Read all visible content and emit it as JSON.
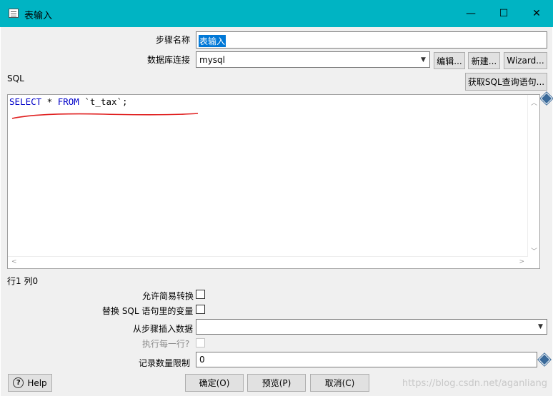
{
  "window": {
    "title": "表输入",
    "minimize": "—",
    "maximize": "☐",
    "close": "✕"
  },
  "form": {
    "step_name_label": "步骤名称",
    "step_name_value": "表输入",
    "db_conn_label": "数据库连接",
    "db_conn_value": "mysql",
    "edit_btn": "编辑...",
    "new_btn": "新建...",
    "wizard_btn": "Wizard...",
    "sql_label": "SQL",
    "get_sql_btn": "获取SQL查询语句...",
    "sql_kw1": "SELECT",
    "sql_mid": " * ",
    "sql_kw2": "FROM",
    "sql_table": " `t_tax`;",
    "cursor_pos": "行1 列0",
    "lazy_conv_label": "允许简易转换",
    "replace_vars_label": "替换 SQL 语句里的变量",
    "insert_from_label": "从步骤插入数据",
    "exec_each_label": "执行每一行?",
    "limit_label": "记录数量限制",
    "limit_value": "0"
  },
  "footer": {
    "help_btn": "Help",
    "ok_btn": "确定(O)",
    "preview_btn": "预览(P)",
    "cancel_btn": "取消(C)",
    "watermark": "https://blog.csdn.net/aganliang"
  },
  "colors": {
    "titlebar": "#00b4c3",
    "sql_keyword": "#0000c8",
    "underline": "#e02020"
  }
}
